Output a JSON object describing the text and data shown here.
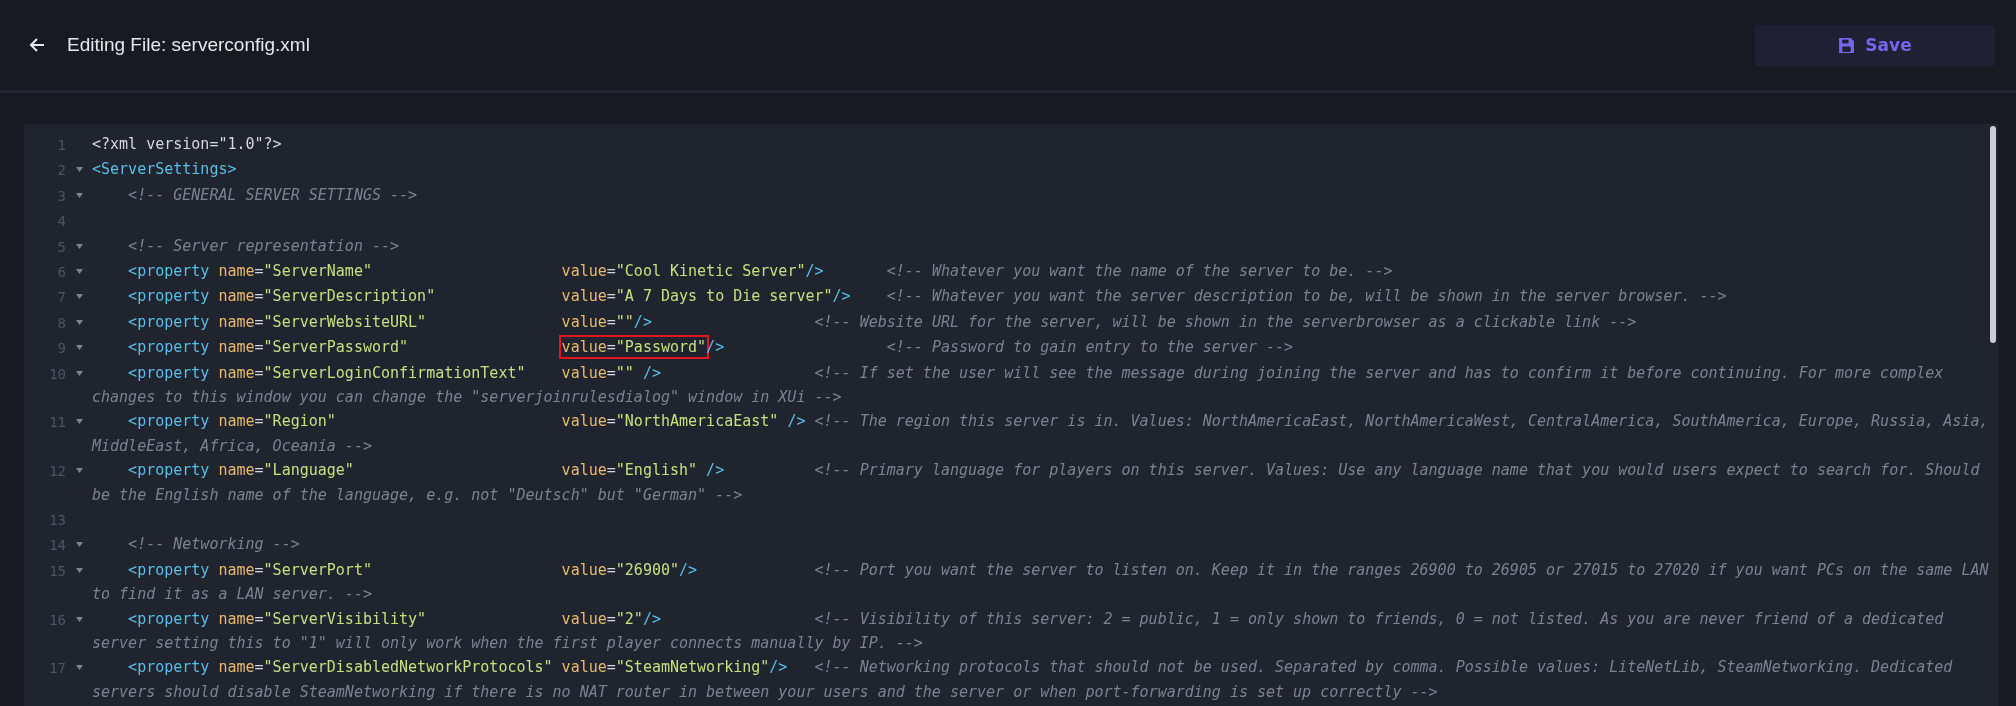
{
  "header": {
    "title": "Editing File: serverconfig.xml",
    "save_button": {
      "label": "Save"
    }
  },
  "editor": {
    "lines": [
      {
        "number": "1",
        "foldable": false,
        "rows": [
          [
            {
              "kind": "plain",
              "text": "<?xml version=\"1.0\"?>"
            }
          ]
        ]
      },
      {
        "number": "2",
        "foldable": true,
        "rows": [
          [
            {
              "kind": "tag",
              "text": "<ServerSettings>"
            }
          ]
        ]
      },
      {
        "number": "3",
        "foldable": true,
        "rows": [
          [
            {
              "kind": "comment",
              "text": "    <!-- GENERAL SERVER SETTINGS -->"
            }
          ]
        ]
      },
      {
        "number": "4",
        "foldable": false
      },
      {
        "number": "5",
        "foldable": true,
        "rows": [
          [
            {
              "kind": "comment",
              "text": "    <!-- Server representation -->"
            }
          ]
        ]
      },
      {
        "number": "6",
        "foldable": true,
        "rows": [
          [
            {
              "kind": "tag",
              "text": "    <property "
            },
            {
              "kind": "attr",
              "text": "name"
            },
            {
              "kind": "plain",
              "text": "="
            },
            {
              "kind": "string",
              "text": "\"ServerName\"                     "
            },
            {
              "kind": "attr",
              "text": "value"
            },
            {
              "kind": "plain",
              "text": "="
            },
            {
              "kind": "string",
              "text": "\"Cool Kinetic Server\""
            },
            {
              "kind": "tag",
              "text": "/>       "
            },
            {
              "kind": "comment",
              "text": "<!-- Whatever you want the name of the server to be. -->"
            }
          ]
        ]
      },
      {
        "number": "7",
        "foldable": true,
        "rows": [
          [
            {
              "kind": "tag",
              "text": "    <property "
            },
            {
              "kind": "attr",
              "text": "name"
            },
            {
              "kind": "plain",
              "text": "="
            },
            {
              "kind": "string",
              "text": "\"ServerDescription\"              "
            },
            {
              "kind": "attr",
              "text": "value"
            },
            {
              "kind": "plain",
              "text": "="
            },
            {
              "kind": "string",
              "text": "\"A 7 Days to Die server\""
            },
            {
              "kind": "tag",
              "text": "/>    "
            },
            {
              "kind": "comment",
              "text": "<!-- Whatever you want the server description to be, will be shown in the server browser. -->"
            }
          ]
        ]
      },
      {
        "number": "8",
        "foldable": true,
        "rows": [
          [
            {
              "kind": "tag",
              "text": "    <property "
            },
            {
              "kind": "attr",
              "text": "name"
            },
            {
              "kind": "plain",
              "text": "="
            },
            {
              "kind": "string",
              "text": "\"ServerWebsiteURL\"               "
            },
            {
              "kind": "attr",
              "text": "value"
            },
            {
              "kind": "plain",
              "text": "="
            },
            {
              "kind": "string",
              "text": "\"\""
            },
            {
              "kind": "tag",
              "text": "/>                  "
            },
            {
              "kind": "comment",
              "text": "<!-- Website URL for the server, will be shown in the serverbrowser as a clickable link -->"
            }
          ]
        ]
      },
      {
        "number": "9",
        "foldable": true,
        "rows": [
          [
            {
              "kind": "tag",
              "text": "    <property "
            },
            {
              "kind": "attr",
              "text": "name"
            },
            {
              "kind": "plain",
              "text": "="
            },
            {
              "kind": "string",
              "text": "\"ServerPassword\"                 "
            },
            {
              "kind": "attr",
              "text": "value",
              "boxed": true
            },
            {
              "kind": "plain",
              "text": "=",
              "boxed": true
            },
            {
              "kind": "string",
              "text": "\"Password\"",
              "boxed": true
            },
            {
              "kind": "tag",
              "text": "/>                  "
            },
            {
              "kind": "comment",
              "text": "<!-- Password to gain entry to the server -->"
            }
          ]
        ]
      },
      {
        "number": "10",
        "foldable": true,
        "rows": [
          [
            {
              "kind": "tag",
              "text": "    <property "
            },
            {
              "kind": "attr",
              "text": "name"
            },
            {
              "kind": "plain",
              "text": "="
            },
            {
              "kind": "string",
              "text": "\"ServerLoginConfirmationText\"    "
            },
            {
              "kind": "attr",
              "text": "value"
            },
            {
              "kind": "plain",
              "text": "="
            },
            {
              "kind": "string",
              "text": "\"\" "
            },
            {
              "kind": "tag",
              "text": "/>                 "
            },
            {
              "kind": "comment",
              "text": "<!-- If set the user will see the message during joining the server and has to confirm it before continuing. For more complex"
            }
          ],
          [
            {
              "kind": "comment",
              "text": "changes to this window you can change the \"serverjoinrulesdialog\" window in XUi -->"
            }
          ]
        ]
      },
      {
        "number": "11",
        "foldable": true,
        "rows": [
          [
            {
              "kind": "tag",
              "text": "    <property "
            },
            {
              "kind": "attr",
              "text": "name"
            },
            {
              "kind": "plain",
              "text": "="
            },
            {
              "kind": "string",
              "text": "\"Region\"                         "
            },
            {
              "kind": "attr",
              "text": "value"
            },
            {
              "kind": "plain",
              "text": "="
            },
            {
              "kind": "string",
              "text": "\"NorthAmericaEast\" "
            },
            {
              "kind": "tag",
              "text": "/> "
            },
            {
              "kind": "comment",
              "text": "<!-- The region this server is in. Values: NorthAmericaEast, NorthAmericaWest, CentralAmerica, SouthAmerica, Europe, Russia, Asia,"
            }
          ],
          [
            {
              "kind": "comment",
              "text": "MiddleEast, Africa, Oceania -->"
            }
          ]
        ]
      },
      {
        "number": "12",
        "foldable": true,
        "rows": [
          [
            {
              "kind": "tag",
              "text": "    <property "
            },
            {
              "kind": "attr",
              "text": "name"
            },
            {
              "kind": "plain",
              "text": "="
            },
            {
              "kind": "string",
              "text": "\"Language\"                       "
            },
            {
              "kind": "attr",
              "text": "value"
            },
            {
              "kind": "plain",
              "text": "="
            },
            {
              "kind": "string",
              "text": "\"English\" "
            },
            {
              "kind": "tag",
              "text": "/>          "
            },
            {
              "kind": "comment",
              "text": "<!-- Primary language for players on this server. Values: Use any language name that you would users expect to search for. Should"
            }
          ],
          [
            {
              "kind": "comment",
              "text": "be the English name of the language, e.g. not \"Deutsch\" but \"German\" -->"
            }
          ]
        ]
      },
      {
        "number": "13",
        "foldable": false
      },
      {
        "number": "14",
        "foldable": true,
        "rows": [
          [
            {
              "kind": "comment",
              "text": "    <!-- Networking -->"
            }
          ]
        ]
      },
      {
        "number": "15",
        "foldable": true,
        "rows": [
          [
            {
              "kind": "tag",
              "text": "    <property "
            },
            {
              "kind": "attr",
              "text": "name"
            },
            {
              "kind": "plain",
              "text": "="
            },
            {
              "kind": "string",
              "text": "\"ServerPort\"                     "
            },
            {
              "kind": "attr",
              "text": "value"
            },
            {
              "kind": "plain",
              "text": "="
            },
            {
              "kind": "string",
              "text": "\"26900\""
            },
            {
              "kind": "tag",
              "text": "/>             "
            },
            {
              "kind": "comment",
              "text": "<!-- Port you want the server to listen on. Keep it in the ranges 26900 to 26905 or 27015 to 27020 if you want PCs on the same LAN"
            }
          ],
          [
            {
              "kind": "comment",
              "text": "to find it as a LAN server. -->"
            }
          ]
        ]
      },
      {
        "number": "16",
        "foldable": true,
        "rows": [
          [
            {
              "kind": "tag",
              "text": "    <property "
            },
            {
              "kind": "attr",
              "text": "name"
            },
            {
              "kind": "plain",
              "text": "="
            },
            {
              "kind": "string",
              "text": "\"ServerVisibility\"               "
            },
            {
              "kind": "attr",
              "text": "value"
            },
            {
              "kind": "plain",
              "text": "="
            },
            {
              "kind": "string",
              "text": "\"2\""
            },
            {
              "kind": "tag",
              "text": "/>                 "
            },
            {
              "kind": "comment",
              "text": "<!-- Visibility of this server: 2 = public, 1 = only shown to friends, 0 = not listed. As you are never friend of a dedicated"
            }
          ],
          [
            {
              "kind": "comment",
              "text": "server setting this to \"1\" will only work when the first player connects manually by IP. -->"
            }
          ]
        ]
      },
      {
        "number": "17",
        "foldable": true,
        "rows": [
          [
            {
              "kind": "tag",
              "text": "    <property "
            },
            {
              "kind": "attr",
              "text": "name"
            },
            {
              "kind": "plain",
              "text": "="
            },
            {
              "kind": "string",
              "text": "\"ServerDisabledNetworkProtocols\" "
            },
            {
              "kind": "attr",
              "text": "value"
            },
            {
              "kind": "plain",
              "text": "="
            },
            {
              "kind": "string",
              "text": "\"SteamNetworking\""
            },
            {
              "kind": "tag",
              "text": "/>   "
            },
            {
              "kind": "comment",
              "text": "<!-- Networking protocols that should not be used. Separated by comma. Possible values: LiteNetLib, SteamNetworking. Dedicated"
            }
          ],
          [
            {
              "kind": "comment",
              "text": "servers should disable SteamNetworking if there is no NAT router in between your users and the server or when port-forwarding is set up correctly -->"
            }
          ]
        ]
      }
    ]
  }
}
